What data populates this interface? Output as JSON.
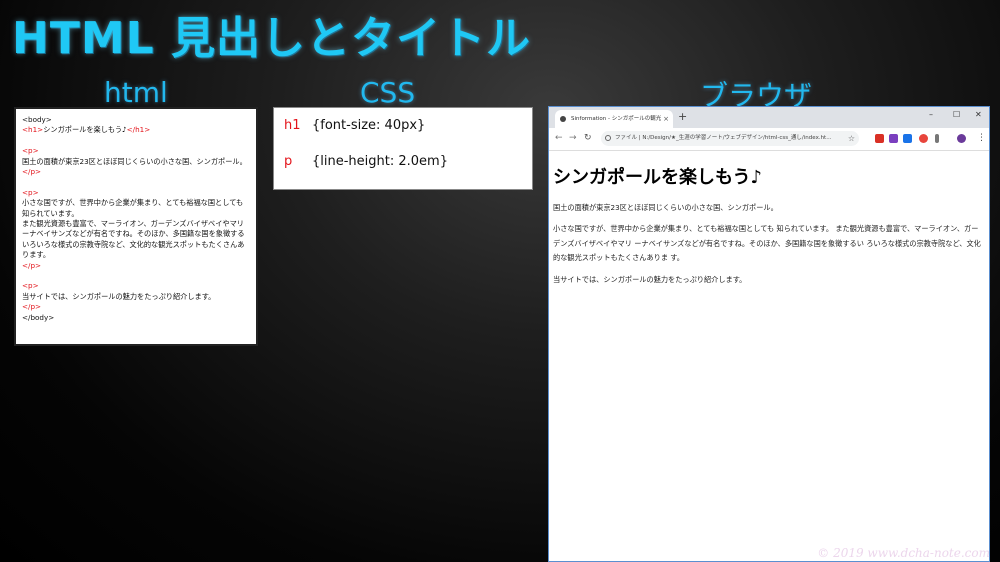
{
  "title": "HTML 見出しとタイトル",
  "labels": {
    "html": "html",
    "css": "CSS",
    "browser": "ブラウザ"
  },
  "html_code": [
    [
      {
        "t": "<body>",
        "tag": false
      }
    ],
    [
      {
        "t": "<h1>",
        "tag": true
      },
      {
        "t": "シンガポールを楽しもう♪",
        "tag": false
      },
      {
        "t": "</h1>",
        "tag": true
      }
    ],
    [],
    [
      {
        "t": "<p>",
        "tag": true
      }
    ],
    [
      {
        "t": "国土の面積が東京23区とほぼ同じくらいの小さな国、シンガポール。",
        "tag": false
      }
    ],
    [
      {
        "t": "</p>",
        "tag": true
      }
    ],
    [],
    [
      {
        "t": "<p>",
        "tag": true
      }
    ],
    [
      {
        "t": "小さな国ですが、世界中から企業が集まり、とても裕福な国としても知られています。",
        "tag": false
      }
    ],
    [
      {
        "t": "また観光資源も豊富で、マーライオン、ガーデンズバイザベイやマリーナベイサンズなどが有名ですね。そのほか、多国籍な国を象徴するいろいろな様式の宗教寺院など、文化的な観光スポットもたくさんあります。",
        "tag": false
      }
    ],
    [
      {
        "t": "</p>",
        "tag": true
      }
    ],
    [],
    [
      {
        "t": "<p>",
        "tag": true
      }
    ],
    [
      {
        "t": "当サイトでは、シンガポールの魅力をたっぷり紹介します。",
        "tag": false
      }
    ],
    [
      {
        "t": "</p>",
        "tag": true
      }
    ],
    [
      {
        "t": "</body>",
        "tag": false
      }
    ]
  ],
  "css_rules": [
    {
      "selector": "h1",
      "declaration": "{font-size: 40px}"
    },
    {
      "selector": "p",
      "declaration": "{line-height: 2.0em}"
    }
  ],
  "browser": {
    "tab_title": "Sinformation - シンガポールの観光",
    "tab_close": "×",
    "new_tab": "+",
    "win_min": "–",
    "win_max": "☐",
    "win_close": "✕",
    "back": "←",
    "forward": "→",
    "reload": "↻",
    "address": "ファイル | N:/Design/★_生涯の学習ノート/ウェブデザイン/html-css_通し/index.ht...",
    "bookmark_star": "☆",
    "menu": "⋮",
    "page_h1": "シンガポールを楽しもう♪",
    "page_paragraphs": [
      "国土の面積が東京23区とほぼ同じくらいの小さな国、シンガポール。",
      "小さな国ですが、世界中から企業が集まり、とても裕福な国としても 知られています。 また観光資源も豊富で、マーライオン、ガーデンズバイザベイやマリ ーナベイサンズなどが有名ですね。そのほか、多国籍な国を象徴するい ろいろな様式の宗教寺院など、文化的な観光スポットもたくさんありま す。",
      "当サイトでは、シンガポールの魅力をたっぷり紹介します。"
    ],
    "extension_colors": [
      "#d93025",
      "#7b3fbf",
      "#1a73e8",
      "#e8453c",
      "#777777",
      "#6a3a9a"
    ]
  },
  "watermark": "© 2019 www.dcha-note.com",
  "colors": {
    "title": "#1fc8f5",
    "label": "#22b8ee",
    "code_tag": "#e3141b",
    "browser_border": "#5b8fd0"
  }
}
